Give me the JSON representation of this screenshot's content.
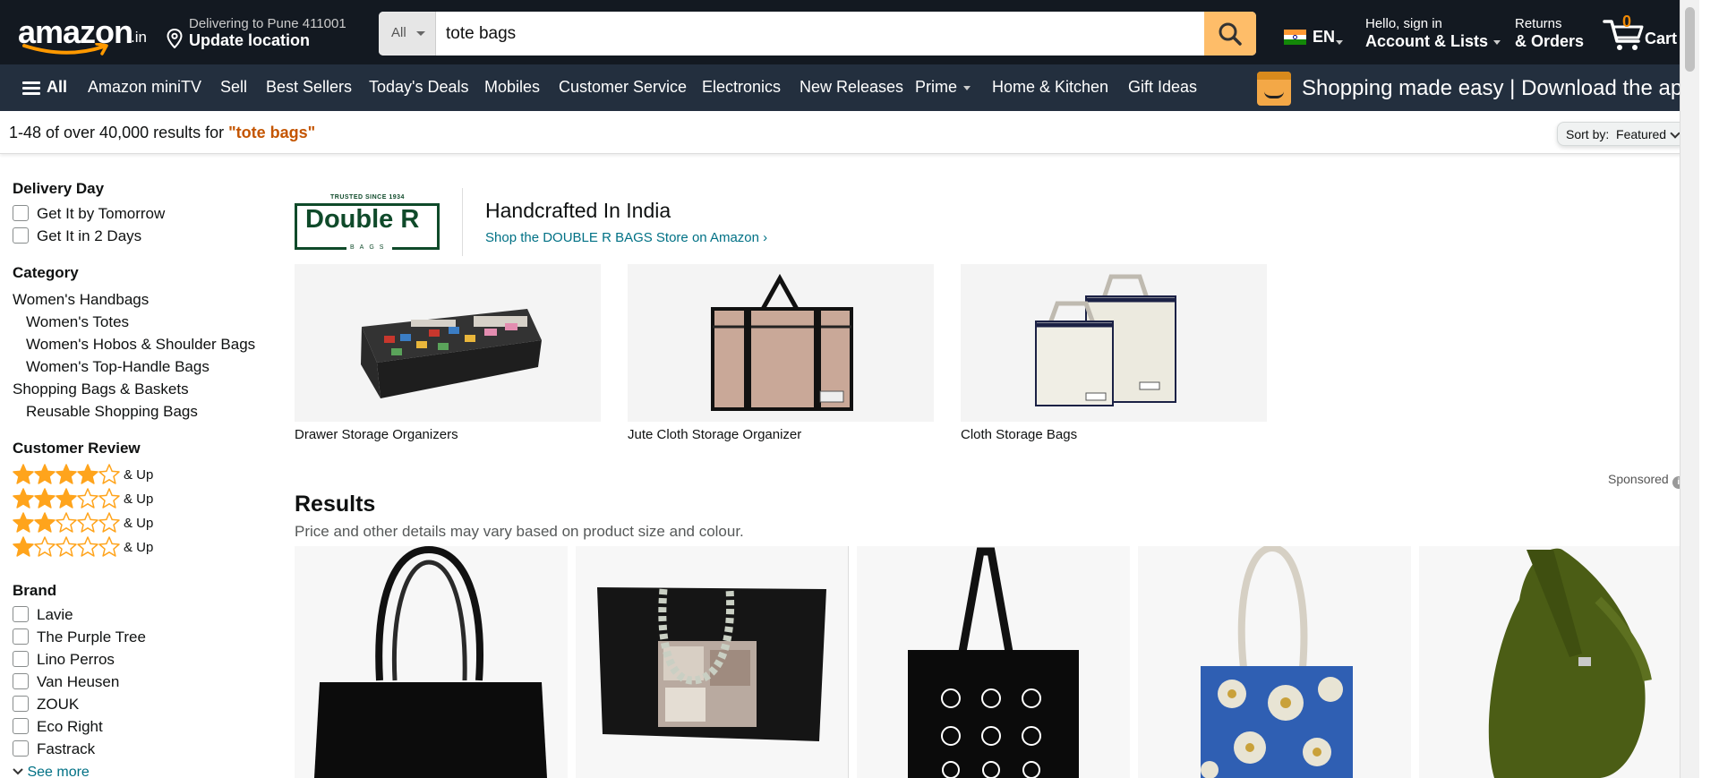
{
  "header": {
    "logo_text": "amazon",
    "logo_suffix": ".in",
    "delivery_line1": "Delivering to Pune 411001",
    "delivery_line2": "Update location",
    "search_category": "All",
    "search_query": "tote bags",
    "language": "EN",
    "account_line1": "Hello, sign in",
    "account_line2": "Account & Lists",
    "returns_line1": "Returns",
    "returns_line2": "& Orders",
    "cart_count": "0",
    "cart_label": "Cart"
  },
  "nav": {
    "all_label": "All",
    "items": [
      "Amazon miniTV",
      "Sell",
      "Best Sellers",
      "Today's Deals",
      "Mobiles",
      "Customer Service",
      "Electronics",
      "New Releases",
      "Prime",
      "Home & Kitchen",
      "Gift Ideas"
    ],
    "promo_text": "Shopping made easy | Download the app"
  },
  "results_bar": {
    "count_text": "1-48 of over 40,000 results for ",
    "query_text": "\"tote bags\"",
    "sort_label": "Sort by:",
    "sort_value": "Featured"
  },
  "sidebar": {
    "delivery_heading": "Delivery Day",
    "delivery_options": [
      "Get It by Tomorrow",
      "Get It in 2 Days"
    ],
    "category_heading": "Category",
    "categories": [
      {
        "label": "Women's Handbags",
        "indent": false
      },
      {
        "label": "Women's Totes",
        "indent": true
      },
      {
        "label": "Women's Hobos & Shoulder Bags",
        "indent": true
      },
      {
        "label": "Women's Top-Handle Bags",
        "indent": true
      },
      {
        "label": "Shopping Bags & Baskets",
        "indent": false
      },
      {
        "label": "Reusable Shopping Bags",
        "indent": true
      }
    ],
    "review_heading": "Customer Review",
    "review_rows": [
      {
        "stars": 4,
        "label": "& Up"
      },
      {
        "stars": 3,
        "label": "& Up"
      },
      {
        "stars": 2,
        "label": "& Up"
      },
      {
        "stars": 1,
        "label": "& Up"
      }
    ],
    "brand_heading": "Brand",
    "brands": [
      "Lavie",
      "The Purple Tree",
      "Lino Perros",
      "Van Heusen",
      "ZOUK",
      "Eco Right",
      "Fastrack"
    ],
    "see_more": "See more"
  },
  "brand_banner": {
    "logo_trusted": "TRUSTED SINCE 1934",
    "logo_name": "Double R",
    "logo_sub": "BAGS",
    "title": "Handcrafted In India",
    "store_link": "Shop the DOUBLE R BAGS Store on Amazon ›",
    "tiles": [
      {
        "caption": "Drawer Storage Organizers",
        "icon": "drawer-organizer-image"
      },
      {
        "caption": "Jute Cloth Storage Organizer",
        "icon": "jute-storage-bag-image"
      },
      {
        "caption": "Cloth Storage Bags",
        "icon": "cloth-storage-bags-image"
      }
    ]
  },
  "results": {
    "sponsored_label": "Sponsored",
    "info_icon": "i",
    "heading": "Results",
    "subheading": "Price and other details may vary based on product size and colour.",
    "products": [
      {
        "icon": "black-leather-tote-image"
      },
      {
        "icon": "black-tote-chain-handle-image"
      },
      {
        "icon": "black-canvas-printed-tote-image"
      },
      {
        "icon": "blue-floral-tote-image"
      },
      {
        "icon": "olive-hobo-bag-image"
      }
    ]
  },
  "colors": {
    "header_bg": "#131921",
    "nav_bg": "#232f3e",
    "search_button": "#febd69",
    "star": "#ffa41c",
    "link": "#007185",
    "query": "#c45500",
    "cart_count": "#f08804"
  }
}
